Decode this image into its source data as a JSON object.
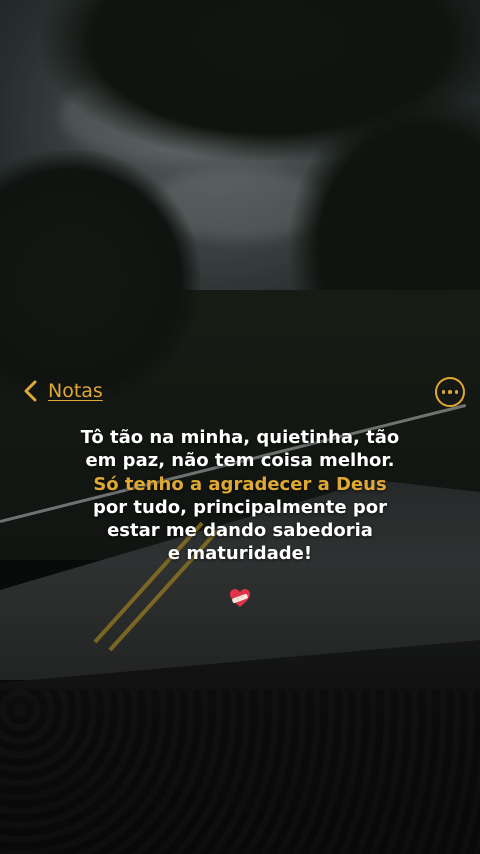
{
  "nav": {
    "back_label": "Notas",
    "back_icon": "chevron-left-icon",
    "more_icon": "ellipsis-circle-icon"
  },
  "note": {
    "lines": [
      "Tô tão na minha, quietinha, tão",
      "em paz, não tem coisa melhor.",
      "Só tenho a agradecer a Deus",
      "por tudo, principalmente por",
      "estar me dando sabedoria",
      "e maturidade!"
    ],
    "highlighted_line_index": 2,
    "emoji_icon": "heart-with-bandage-icon"
  },
  "colors": {
    "accent": "#e0a834",
    "text": "#ffffff",
    "heart": "#e0334a"
  }
}
